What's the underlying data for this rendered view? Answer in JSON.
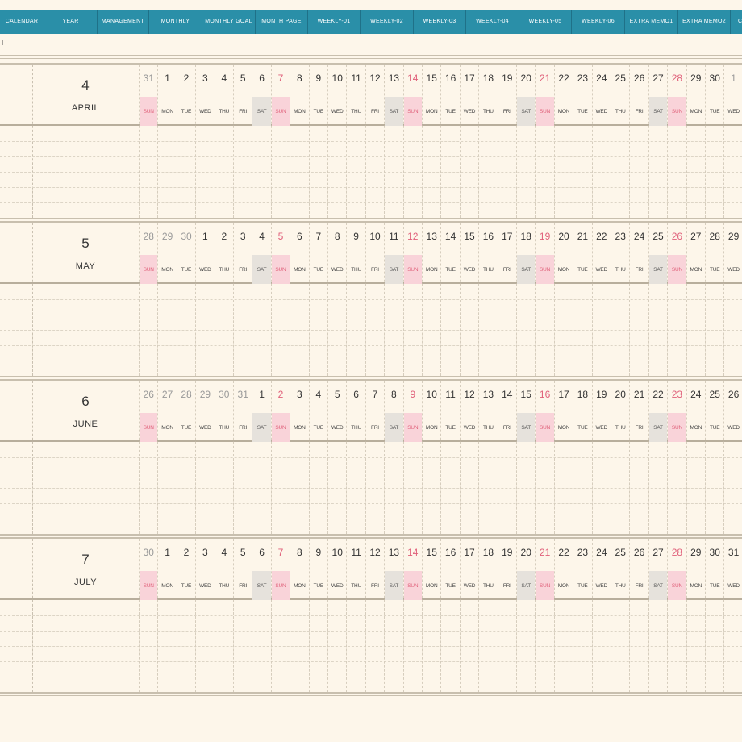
{
  "top_text": "T",
  "tabs": [
    "CALENDAR",
    "YEAR",
    "MANAGEMENT",
    "MONTHLY",
    "MONTHLY GOAL",
    "MONTH PAGE",
    "WEEKLY-01",
    "WEEKLY-02",
    "WEEKLY-03",
    "WEEKLY-04",
    "WEEKLY-05",
    "WEEKLY-06",
    "EXTRA MEMO1",
    "EXTRA MEMO2",
    "CO"
  ],
  "months": [
    {
      "number": "4",
      "name": "APRIL",
      "days": [
        {
          "n": "31",
          "d": "SUN",
          "faded": true
        },
        {
          "n": "1",
          "d": "MON"
        },
        {
          "n": "2",
          "d": "TUE"
        },
        {
          "n": "3",
          "d": "WED"
        },
        {
          "n": "4",
          "d": "THU"
        },
        {
          "n": "5",
          "d": "FRI"
        },
        {
          "n": "6",
          "d": "SAT"
        },
        {
          "n": "7",
          "d": "SUN"
        },
        {
          "n": "8",
          "d": "MON"
        },
        {
          "n": "9",
          "d": "TUE"
        },
        {
          "n": "10",
          "d": "WED"
        },
        {
          "n": "11",
          "d": "THU"
        },
        {
          "n": "12",
          "d": "FRI"
        },
        {
          "n": "13",
          "d": "SAT"
        },
        {
          "n": "14",
          "d": "SUN"
        },
        {
          "n": "15",
          "d": "MON"
        },
        {
          "n": "16",
          "d": "TUE"
        },
        {
          "n": "17",
          "d": "WED"
        },
        {
          "n": "18",
          "d": "THU"
        },
        {
          "n": "19",
          "d": "FRI"
        },
        {
          "n": "20",
          "d": "SAT"
        },
        {
          "n": "21",
          "d": "SUN"
        },
        {
          "n": "22",
          "d": "MON"
        },
        {
          "n": "23",
          "d": "TUE"
        },
        {
          "n": "24",
          "d": "WED"
        },
        {
          "n": "25",
          "d": "THU"
        },
        {
          "n": "26",
          "d": "FRI"
        },
        {
          "n": "27",
          "d": "SAT"
        },
        {
          "n": "28",
          "d": "SUN"
        },
        {
          "n": "29",
          "d": "MON"
        },
        {
          "n": "30",
          "d": "TUE"
        },
        {
          "n": "1",
          "d": "WED",
          "faded": true
        }
      ]
    },
    {
      "number": "5",
      "name": "MAY",
      "days": [
        {
          "n": "28",
          "d": "SUN",
          "faded": true
        },
        {
          "n": "29",
          "d": "MON",
          "faded": true
        },
        {
          "n": "30",
          "d": "TUE",
          "faded": true
        },
        {
          "n": "1",
          "d": "WED"
        },
        {
          "n": "2",
          "d": "THU"
        },
        {
          "n": "3",
          "d": "FRI"
        },
        {
          "n": "4",
          "d": "SAT"
        },
        {
          "n": "5",
          "d": "SUN"
        },
        {
          "n": "6",
          "d": "MON"
        },
        {
          "n": "7",
          "d": "TUE"
        },
        {
          "n": "8",
          "d": "WED"
        },
        {
          "n": "9",
          "d": "THU"
        },
        {
          "n": "10",
          "d": "FRI"
        },
        {
          "n": "11",
          "d": "SAT"
        },
        {
          "n": "12",
          "d": "SUN"
        },
        {
          "n": "13",
          "d": "MON"
        },
        {
          "n": "14",
          "d": "TUE"
        },
        {
          "n": "15",
          "d": "WED"
        },
        {
          "n": "16",
          "d": "THU"
        },
        {
          "n": "17",
          "d": "FRI"
        },
        {
          "n": "18",
          "d": "SAT"
        },
        {
          "n": "19",
          "d": "SUN"
        },
        {
          "n": "20",
          "d": "MON"
        },
        {
          "n": "21",
          "d": "TUE"
        },
        {
          "n": "22",
          "d": "WED"
        },
        {
          "n": "23",
          "d": "THU"
        },
        {
          "n": "24",
          "d": "FRI"
        },
        {
          "n": "25",
          "d": "SAT"
        },
        {
          "n": "26",
          "d": "SUN"
        },
        {
          "n": "27",
          "d": "MON"
        },
        {
          "n": "28",
          "d": "TUE"
        },
        {
          "n": "29",
          "d": "WED"
        }
      ]
    },
    {
      "number": "6",
      "name": "JUNE",
      "days": [
        {
          "n": "26",
          "d": "SUN",
          "faded": true
        },
        {
          "n": "27",
          "d": "MON",
          "faded": true
        },
        {
          "n": "28",
          "d": "TUE",
          "faded": true
        },
        {
          "n": "29",
          "d": "WED",
          "faded": true
        },
        {
          "n": "30",
          "d": "THU",
          "faded": true
        },
        {
          "n": "31",
          "d": "FRI",
          "faded": true
        },
        {
          "n": "1",
          "d": "SAT"
        },
        {
          "n": "2",
          "d": "SUN"
        },
        {
          "n": "3",
          "d": "MON"
        },
        {
          "n": "4",
          "d": "TUE"
        },
        {
          "n": "5",
          "d": "WED"
        },
        {
          "n": "6",
          "d": "THU"
        },
        {
          "n": "7",
          "d": "FRI"
        },
        {
          "n": "8",
          "d": "SAT"
        },
        {
          "n": "9",
          "d": "SUN"
        },
        {
          "n": "10",
          "d": "MON"
        },
        {
          "n": "11",
          "d": "TUE"
        },
        {
          "n": "12",
          "d": "WED"
        },
        {
          "n": "13",
          "d": "THU"
        },
        {
          "n": "14",
          "d": "FRI"
        },
        {
          "n": "15",
          "d": "SAT"
        },
        {
          "n": "16",
          "d": "SUN"
        },
        {
          "n": "17",
          "d": "MON"
        },
        {
          "n": "18",
          "d": "TUE"
        },
        {
          "n": "19",
          "d": "WED"
        },
        {
          "n": "20",
          "d": "THU"
        },
        {
          "n": "21",
          "d": "FRI"
        },
        {
          "n": "22",
          "d": "SAT"
        },
        {
          "n": "23",
          "d": "SUN"
        },
        {
          "n": "24",
          "d": "MON"
        },
        {
          "n": "25",
          "d": "TUE"
        },
        {
          "n": "26",
          "d": "WED"
        }
      ]
    },
    {
      "number": "7",
      "name": "JULY",
      "days": [
        {
          "n": "30",
          "d": "SUN",
          "faded": true
        },
        {
          "n": "1",
          "d": "MON"
        },
        {
          "n": "2",
          "d": "TUE"
        },
        {
          "n": "3",
          "d": "WED"
        },
        {
          "n": "4",
          "d": "THU"
        },
        {
          "n": "5",
          "d": "FRI"
        },
        {
          "n": "6",
          "d": "SAT"
        },
        {
          "n": "7",
          "d": "SUN"
        },
        {
          "n": "8",
          "d": "MON"
        },
        {
          "n": "9",
          "d": "TUE"
        },
        {
          "n": "10",
          "d": "WED"
        },
        {
          "n": "11",
          "d": "THU"
        },
        {
          "n": "12",
          "d": "FRI"
        },
        {
          "n": "13",
          "d": "SAT"
        },
        {
          "n": "14",
          "d": "SUN"
        },
        {
          "n": "15",
          "d": "MON"
        },
        {
          "n": "16",
          "d": "TUE"
        },
        {
          "n": "17",
          "d": "WED"
        },
        {
          "n": "18",
          "d": "THU"
        },
        {
          "n": "19",
          "d": "FRI"
        },
        {
          "n": "20",
          "d": "SAT"
        },
        {
          "n": "21",
          "d": "SUN"
        },
        {
          "n": "22",
          "d": "MON"
        },
        {
          "n": "23",
          "d": "TUE"
        },
        {
          "n": "24",
          "d": "WED"
        },
        {
          "n": "25",
          "d": "THU"
        },
        {
          "n": "26",
          "d": "FRI"
        },
        {
          "n": "27",
          "d": "SAT"
        },
        {
          "n": "28",
          "d": "SUN"
        },
        {
          "n": "29",
          "d": "MON"
        },
        {
          "n": "30",
          "d": "TUE"
        },
        {
          "n": "31",
          "d": "WED"
        }
      ]
    }
  ],
  "colors": {
    "tab_bar": "#2a8fa8",
    "sunday": "#e0607a",
    "sunday_bg": "#f9d3d9",
    "saturday_bg": "#e6e2dc",
    "page_bg": "#fdf6ea"
  }
}
